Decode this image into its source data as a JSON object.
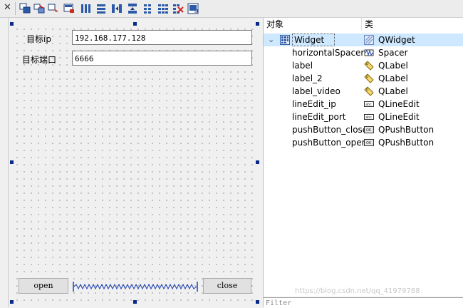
{
  "toolbar": {
    "icons": [
      "close-icon",
      "edit-widgets-icon",
      "edit-signals-slots-icon",
      "edit-buddies-icon",
      "edit-tab-order-icon",
      "layout-horizontal-icon",
      "layout-vertical-icon",
      "layout-horizontal-splitter-icon",
      "layout-vertical-splitter-icon",
      "layout-form-icon",
      "layout-grid-icon",
      "break-layout-icon",
      "adjust-size-icon"
    ]
  },
  "form": {
    "ip_label": "目标ip",
    "ip_value": "192.168.177.128",
    "port_label": "目标端口",
    "port_value": "6666",
    "open_button": "open",
    "close_button": "close"
  },
  "object_inspector": {
    "col_object": "对象",
    "col_class": "类",
    "root": {
      "name": "Widget",
      "cls": "QWidget"
    },
    "children": [
      {
        "name": "horizontalSpacer",
        "cls": "Spacer",
        "icon": "spacer-icon"
      },
      {
        "name": "label",
        "cls": "QLabel",
        "icon": "label-tag-icon"
      },
      {
        "name": "label_2",
        "cls": "QLabel",
        "icon": "label-tag-icon"
      },
      {
        "name": "label_video",
        "cls": "QLabel",
        "icon": "label-tag-icon"
      },
      {
        "name": "lineEdit_ip",
        "cls": "QLineEdit",
        "icon": "lineedit-icon"
      },
      {
        "name": "lineEdit_port",
        "cls": "QLineEdit",
        "icon": "lineedit-icon"
      },
      {
        "name": "pushButton_close",
        "cls": "QPushButton",
        "icon": "pushbutton-icon"
      },
      {
        "name": "pushButton_open",
        "cls": "QPushButton",
        "icon": "pushbutton-icon"
      }
    ]
  },
  "filter_placeholder": "Filter",
  "watermark": "https://blog.csdn.net/qq_41979788",
  "colors": {
    "selection": "#cde8ff",
    "handle": "#0a2a8a",
    "spacer": "#1b3fb0"
  }
}
